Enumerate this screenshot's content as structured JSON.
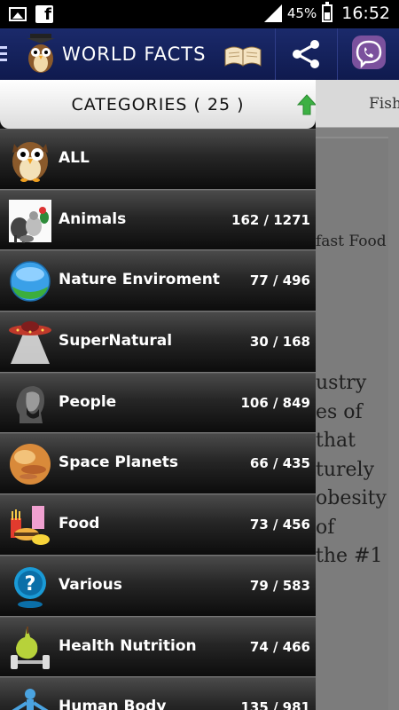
{
  "status_bar": {
    "battery_percent": "45%",
    "time": "16:52"
  },
  "app_bar": {
    "title": "WORLD FACTS"
  },
  "drawer": {
    "header": "CATEGORIES ( 25 )",
    "categories": [
      {
        "label": "ALL",
        "count": "",
        "icon": "owl-icon"
      },
      {
        "label": "Animals",
        "count": "162 / 1271",
        "icon": "animals-icon"
      },
      {
        "label": "Nature Enviroment",
        "count": "77 / 496",
        "icon": "globe-icon"
      },
      {
        "label": "SuperNatural",
        "count": "30 / 168",
        "icon": "ufo-icon"
      },
      {
        "label": "People",
        "count": "106 / 849",
        "icon": "portrait-icon"
      },
      {
        "label": "Space Planets",
        "count": "66 / 435",
        "icon": "planet-icon"
      },
      {
        "label": "Food",
        "count": "73 / 456",
        "icon": "food-icon"
      },
      {
        "label": "Various",
        "count": "79 / 583",
        "icon": "question-icon"
      },
      {
        "label": "Health Nutrition",
        "count": "74 / 466",
        "icon": "pear-dumbbell-icon"
      },
      {
        "label": "Human Body",
        "count": "135 / 981",
        "icon": "human-body-icon"
      }
    ]
  },
  "background": {
    "tab": "Fish",
    "card_title": "fast Food",
    "lines": [
      "ustry",
      "es of",
      " that",
      "turely",
      "obesity",
      "of",
      "the #1"
    ]
  },
  "colors": {
    "app_bar": "#1b2a6b",
    "viber": "#7b519d",
    "up_arrow": "#3cb043"
  }
}
